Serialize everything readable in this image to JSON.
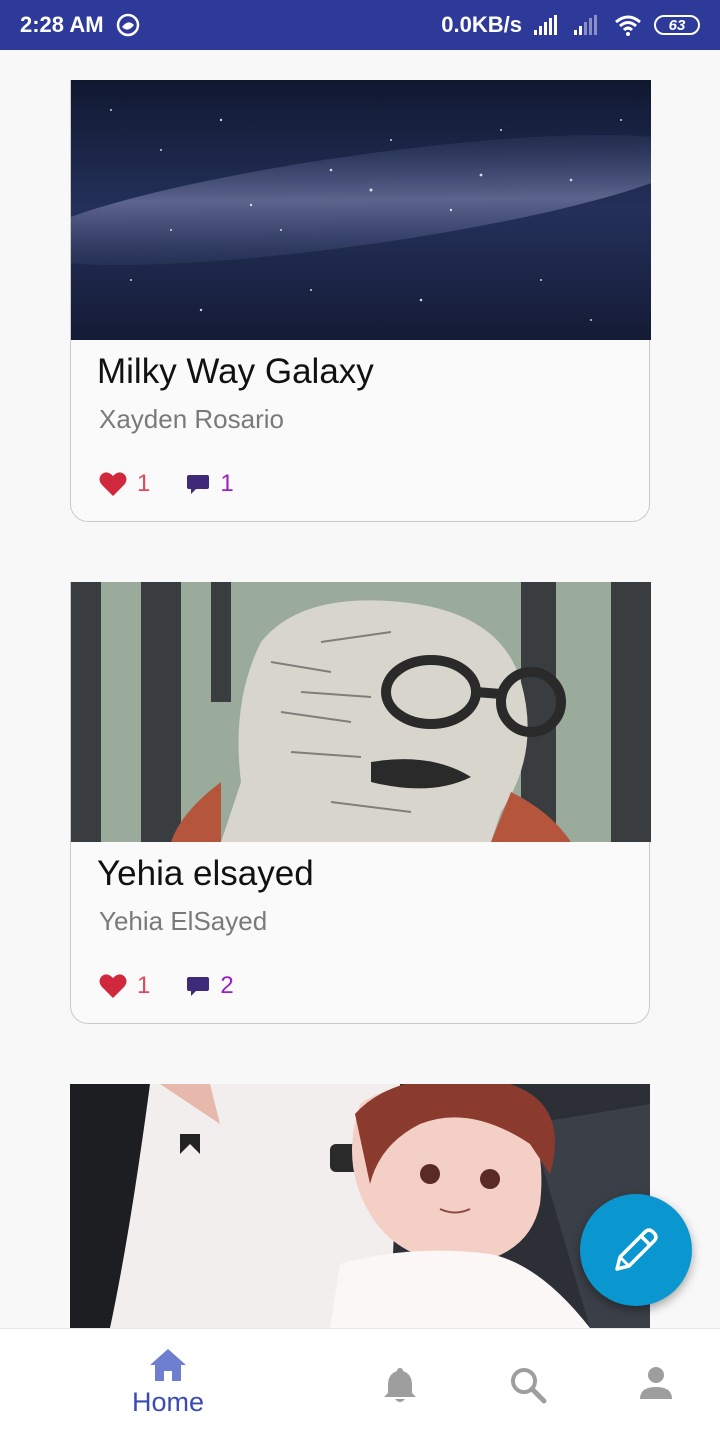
{
  "status_bar": {
    "time": "2:28 AM",
    "network_speed": "0.0KB/s",
    "battery": "63"
  },
  "posts": [
    {
      "title": "Milky Way Galaxy",
      "author": "Xayden Rosario",
      "likes": "1",
      "comments": "1",
      "image": "galaxy-photo"
    },
    {
      "title": "Yehia elsayed",
      "author": "Yehia ElSayed",
      "likes": "1",
      "comments": "2",
      "image": "woodcut-portrait"
    },
    {
      "image": "anime-illustration"
    }
  ],
  "bottom_nav": {
    "home_label": "Home",
    "icons": [
      "home-icon",
      "bell-icon",
      "search-icon",
      "person-icon"
    ]
  },
  "fab": {
    "icon": "pencil-icon"
  },
  "colors": {
    "status_bar": "#2e3a9a",
    "accent_nav": "#3a4bb5",
    "fab": "#0a97d0",
    "like": "#e0485a",
    "comment": "#9c1fc4"
  }
}
